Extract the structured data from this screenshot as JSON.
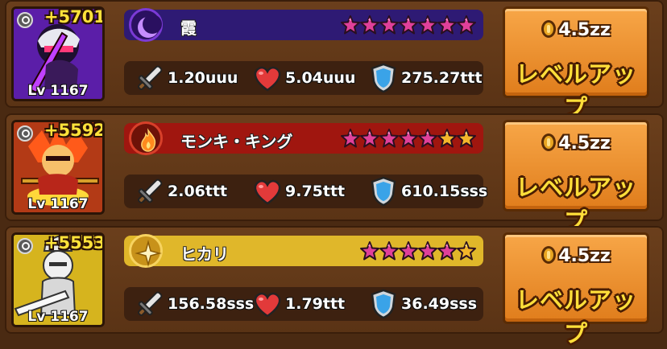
{
  "heroes": [
    {
      "bonus": "+5701",
      "level": "Lv 1167",
      "name": "霞",
      "element": "moon-icon",
      "bar_color": "#2e1a74",
      "stars": [
        "pink",
        "pink",
        "pink",
        "pink",
        "pink",
        "pink",
        "pink"
      ],
      "attack": "1.20uuu",
      "hp": "5.04uuu",
      "defense": "275.27ttt",
      "cost": "4.5zz",
      "button_label": "レベルアップ"
    },
    {
      "bonus": "+5592",
      "level": "Lv 1167",
      "name": "モンキ・キング",
      "element": "fire-icon",
      "bar_color": "#a0160f",
      "stars": [
        "pink",
        "pink",
        "pink",
        "pink",
        "pink",
        "gold",
        "gold"
      ],
      "attack": "2.06ttt",
      "hp": "9.75ttt",
      "defense": "610.15sss",
      "cost": "4.5zz",
      "button_label": "レベルアップ"
    },
    {
      "bonus": "+5553",
      "level": "Lv 1167",
      "name": "ヒカリ",
      "element": "light-icon",
      "bar_color": "#e0b72a",
      "stars": [
        "pink",
        "pink",
        "pink",
        "pink",
        "pink",
        "gold"
      ],
      "attack": "156.58sss",
      "hp": "1.79ttt",
      "defense": "36.49sss",
      "cost": "4.5zz",
      "button_label": "レベルアップ"
    }
  ]
}
